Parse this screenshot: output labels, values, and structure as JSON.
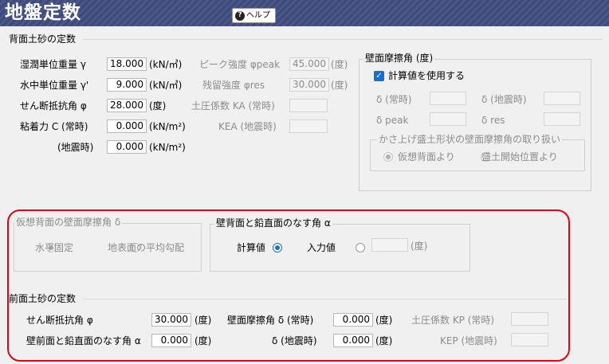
{
  "header": {
    "title": "地盤定数",
    "help_label": "ヘルプ"
  },
  "back_soil": {
    "section_title": "背面土砂の定数",
    "wet_weight": {
      "label": "湿潤単位重量 γ",
      "value": "18.000",
      "unit": "(kN/㎥)"
    },
    "sub_weight": {
      "label": "水中単位重量 γ'",
      "value": "9.000",
      "unit": "(kN/㎥)"
    },
    "shear_angle": {
      "label": "せん断抵抗角 φ",
      "value": "28.000",
      "unit": "(度)"
    },
    "cohesion": {
      "label": "粘着力 C (常時)",
      "value": "0.000",
      "unit": "(kN/m²)"
    },
    "cohesion_eq": {
      "label": "(地震時)",
      "value": "0.000",
      "unit": "(kN/m²)"
    },
    "peak": {
      "label": "ピーク強度 φpeak",
      "value": "45.000",
      "unit": "(度)"
    },
    "residual": {
      "label": "残留強度 φres",
      "value": "30.000",
      "unit": "(度)"
    },
    "ka_normal": {
      "label": "土圧係数 KA (常時)",
      "value": ""
    },
    "kea": {
      "label": "KEA (地震時)",
      "value": ""
    }
  },
  "wall_friction": {
    "group_title": "壁面摩擦角 (度)",
    "use_calc_label": "計算値を使用する",
    "d_normal": "δ (常時)",
    "d_eq": "δ (地震時)",
    "d_peak": "δ peak",
    "d_res": "δ res",
    "slope_title": "かさ上げ盛土形状の壁面摩擦角の取り扱い",
    "opt_virtual": "仮想背面より",
    "opt_fill": "盛土開始位置より"
  },
  "virtual_back": {
    "group_title": "仮想背面の壁面摩擦角 δ",
    "opt_horizontal": "水平固定",
    "opt_average": "地表面の平均勾配"
  },
  "wall_angle": {
    "group_title": "壁背面と鉛直面のなす角 α",
    "opt_calc": "計算値",
    "opt_input": "入力値",
    "value": "",
    "unit": "(度)"
  },
  "front_soil": {
    "section_title": "前面土砂の定数",
    "shear_angle": {
      "label": "せん断抵抗角 φ",
      "value": "30.000",
      "unit": "(度)"
    },
    "front_angle": {
      "label": "壁前面と鉛直面のなす角 α",
      "value": "0.000",
      "unit": "(度)"
    },
    "wall_friction": {
      "label": "壁面摩擦角 δ (常時)",
      "value": "0.000",
      "unit": "(度)"
    },
    "wall_friction_eq": {
      "label": "δ (地震時)",
      "value": "0.000",
      "unit": "(度)"
    },
    "kp_normal": {
      "label": "土圧係数 KP (常時)",
      "value": ""
    },
    "kep": {
      "label": "KEP (地震時)",
      "value": ""
    }
  },
  "colors": {
    "titlebar": "#3d4a7a",
    "accent": "#1d6dd1",
    "highlight": "#e50012"
  }
}
